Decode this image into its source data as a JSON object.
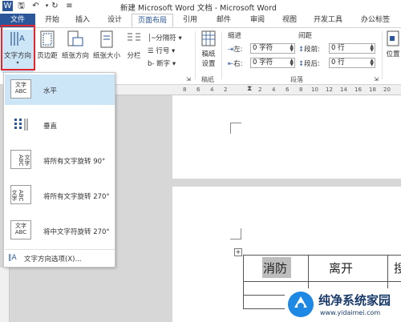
{
  "window": {
    "title": "新建 Microsoft Word 文档 - Microsoft Word"
  },
  "quick_access": {
    "save_icon": "save-icon",
    "undo_icon": "undo-icon",
    "redo_icon": "redo-icon"
  },
  "tabs": [
    {
      "label": "文件"
    },
    {
      "label": "开始"
    },
    {
      "label": "插入"
    },
    {
      "label": "设计"
    },
    {
      "label": "页面布局"
    },
    {
      "label": "引用"
    },
    {
      "label": "邮件"
    },
    {
      "label": "审阅"
    },
    {
      "label": "视图"
    },
    {
      "label": "开发工具"
    },
    {
      "label": "办公标签"
    }
  ],
  "ribbon": {
    "text_direction": "文字方向",
    "margins": "页边距",
    "orientation": "纸张方向",
    "size": "纸张大小",
    "columns": "分栏",
    "breaks": "分隔符",
    "line_numbers": "行号",
    "hyphenation": "断字",
    "manuscript_setup_line1": "稿纸",
    "manuscript_setup_line2": "设置",
    "manuscript_group": "稿纸",
    "indent_header": "缩进",
    "spacing_header": "间距",
    "indent_left_label": "左:",
    "indent_left_value": "0 字符",
    "indent_right_label": "右:",
    "indent_right_value": "0 字符",
    "space_before_label": "段前:",
    "space_before_value": "0 行",
    "space_after_label": "段后:",
    "space_after_value": "0 行",
    "paragraph_group": "段落",
    "position": "位置"
  },
  "ruler": {
    "ticks": [
      "8",
      "6",
      "4",
      "2",
      "2",
      "4",
      "6",
      "8",
      "10",
      "12",
      "14",
      "16",
      "18",
      "20"
    ]
  },
  "dropdown": {
    "items": [
      {
        "label": "水平",
        "icon_text_1": "文字",
        "icon_text_2": "ABC"
      },
      {
        "label": "垂直",
        "icon_text_1": "",
        "icon_text_2": ""
      },
      {
        "label": "将所有文字旋转 90°",
        "icon_text_1": "文字",
        "icon_text_2": "ABC"
      },
      {
        "label": "将所有文字旋转 270°",
        "icon_text_1": "文字",
        "icon_text_2": "ABC"
      },
      {
        "label": "将中文字符旋转 270°",
        "icon_text_1": "文字",
        "icon_text_2": "ABC"
      }
    ],
    "options": "文字方向选项(X)..."
  },
  "document": {
    "table_row1": [
      "消防",
      "离开",
      "搜"
    ]
  },
  "watermark": {
    "title": "纯净系统家园",
    "url": "www.yidaimei.com"
  }
}
